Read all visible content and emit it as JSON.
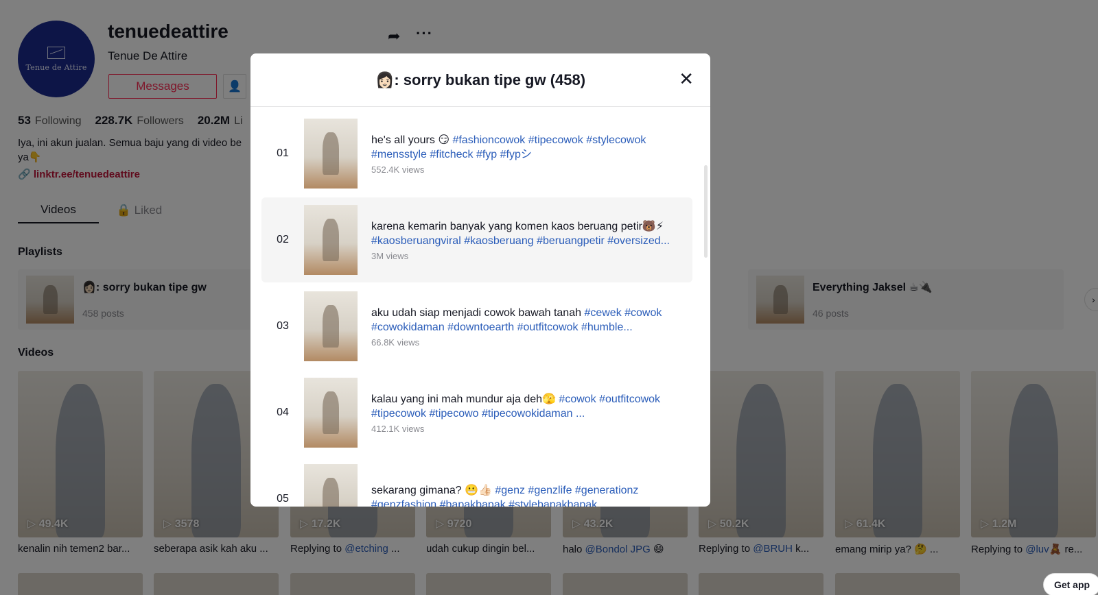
{
  "profile": {
    "username": "tenuedeattire",
    "nickname": "Tenue De Attire",
    "avatar_text": "Tenue de Attire",
    "messages_label": "Messages",
    "following_count": "53",
    "following_label": "Following",
    "followers_count": "228.7K",
    "followers_label": "Followers",
    "likes_count": "20.2M",
    "likes_label": "Li",
    "bio": "Iya, ini akun jualan. Semua baju yang di video be ya👇",
    "link": "linktr.ee/tenuedeattire"
  },
  "tabs": {
    "videos": "Videos",
    "liked": "Liked"
  },
  "sections": {
    "playlists": "Playlists",
    "videos": "Videos"
  },
  "playlists": [
    {
      "title": "👩🏻: sorry bukan tipe gw",
      "count": "458 posts"
    },
    {
      "title": "Everything Jaksel ☕🔌",
      "count": "46 posts"
    }
  ],
  "videos": [
    {
      "views": "49.4K",
      "caption": "kenalin nih temen2 bar..."
    },
    {
      "views": "3578",
      "caption": "seberapa asik kah aku ..."
    },
    {
      "views": "17.2K",
      "caption_prefix": "Replying to ",
      "mention": "@etching",
      "caption_suffix": " ..."
    },
    {
      "views": "9720",
      "caption": "udah cukup dingin bel..."
    },
    {
      "views": "43.2K",
      "caption_prefix": "halo ",
      "mention": "@Bondol JPG",
      "caption_suffix": " 😄"
    },
    {
      "views": "50.2K",
      "caption_prefix": "Replying to ",
      "mention": "@BRUH",
      "caption_suffix": " k..."
    },
    {
      "views": "61.4K",
      "caption": "emang mirip ya? 🤔 ..."
    },
    {
      "views": "1.2M",
      "caption_prefix": "Replying to ",
      "mention": "@luv🧸",
      "caption_suffix": " re..."
    }
  ],
  "get_app": "Get app",
  "modal": {
    "title": "👩🏻: sorry bukan tipe gw (458)",
    "items": [
      {
        "num": "01",
        "text": "he's all yours 😏 ",
        "tags": "#fashioncowok #tipecowok #stylecowok #mensstyle #fitcheck #fyp #fypシ",
        "views": "552.4K views"
      },
      {
        "num": "02",
        "text": "karena kemarin banyak yang komen kaos beruang petir🐻⚡ ",
        "tags": "#kaosberuangviral #kaosberuang #beruangpetir #oversized...",
        "views": "3M views"
      },
      {
        "num": "03",
        "text": "aku udah siap menjadi cowok bawah tanah ",
        "tags": "#cewek #cowok #cowokidaman #downtoearth #outfitcowok #humble...",
        "views": "66.8K views"
      },
      {
        "num": "04",
        "text": "kalau yang ini mah mundur aja deh🫣 ",
        "tags": "#cowok #outfitcowok #tipecowok #tipecowo #tipecowokidaman ...",
        "views": "412.1K views"
      },
      {
        "num": "05",
        "text": "sekarang gimana? 😬👍🏻 ",
        "tags": "#genz #genzlife #generationz #genzfashion #bapakbapak #stylebapakbapak...",
        "views": ""
      }
    ]
  }
}
